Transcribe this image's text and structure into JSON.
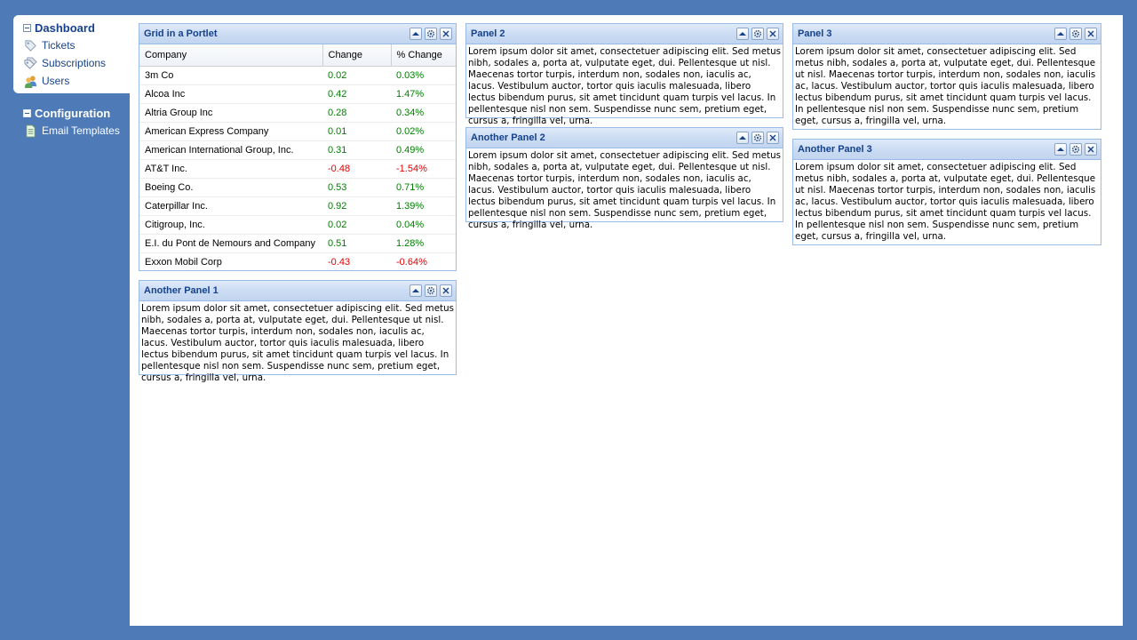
{
  "nav": {
    "dashboard": {
      "label": "Dashboard",
      "items": [
        {
          "label": "Tickets",
          "icon": "tag-icon"
        },
        {
          "label": "Subscriptions",
          "icon": "tag-multiple-icon"
        },
        {
          "label": "Users",
          "icon": "users-icon"
        }
      ]
    },
    "configuration": {
      "label": "Configuration",
      "items": [
        {
          "label": "Email Templates",
          "icon": "document-icon"
        }
      ]
    }
  },
  "lorem": "Lorem ipsum dolor sit amet, consectetuer adipiscing elit. Sed metus nibh, sodales a, porta at, vulputate eget, dui. Pellentesque ut nisl. Maecenas tortor turpis, interdum non, sodales non, iaculis ac, lacus. Vestibulum auctor, tortor quis iaculis malesuada, libero lectus bibendum purus, sit amet tincidunt quam turpis vel lacus. In pellentesque nisl non sem. Suspendisse nunc sem, pretium eget, cursus a, fringilla vel, urna.",
  "panels": {
    "grid": {
      "title": "Grid in a Portlet"
    },
    "another1": {
      "title": "Another Panel 1"
    },
    "panel2": {
      "title": "Panel 2"
    },
    "another2": {
      "title": "Another Panel 2"
    },
    "panel3": {
      "title": "Panel 3"
    },
    "another3": {
      "title": "Another Panel 3"
    }
  },
  "grid": {
    "columns": [
      "Company",
      "Change",
      "% Change"
    ],
    "rows": [
      {
        "company": "3m Co",
        "change": "0.02",
        "pct": "0.03%"
      },
      {
        "company": "Alcoa Inc",
        "change": "0.42",
        "pct": "1.47%"
      },
      {
        "company": "Altria Group Inc",
        "change": "0.28",
        "pct": "0.34%"
      },
      {
        "company": "American Express Company",
        "change": "0.01",
        "pct": "0.02%"
      },
      {
        "company": "American International Group, Inc.",
        "change": "0.31",
        "pct": "0.49%"
      },
      {
        "company": "AT&T Inc.",
        "change": "-0.48",
        "pct": "-1.54%"
      },
      {
        "company": "Boeing Co.",
        "change": "0.53",
        "pct": "0.71%"
      },
      {
        "company": "Caterpillar Inc.",
        "change": "0.92",
        "pct": "1.39%"
      },
      {
        "company": "Citigroup, Inc.",
        "change": "0.02",
        "pct": "0.04%"
      },
      {
        "company": "E.I. du Pont de Nemours and Company",
        "change": "0.51",
        "pct": "1.28%"
      },
      {
        "company": "Exxon Mobil Corp",
        "change": "-0.43",
        "pct": "-0.64%"
      }
    ]
  },
  "colors": {
    "background": "#4e7bb8",
    "header_text": "#15428b",
    "positive": "#008000",
    "negative": "#e00000",
    "panel_border": "#99bbe8"
  }
}
